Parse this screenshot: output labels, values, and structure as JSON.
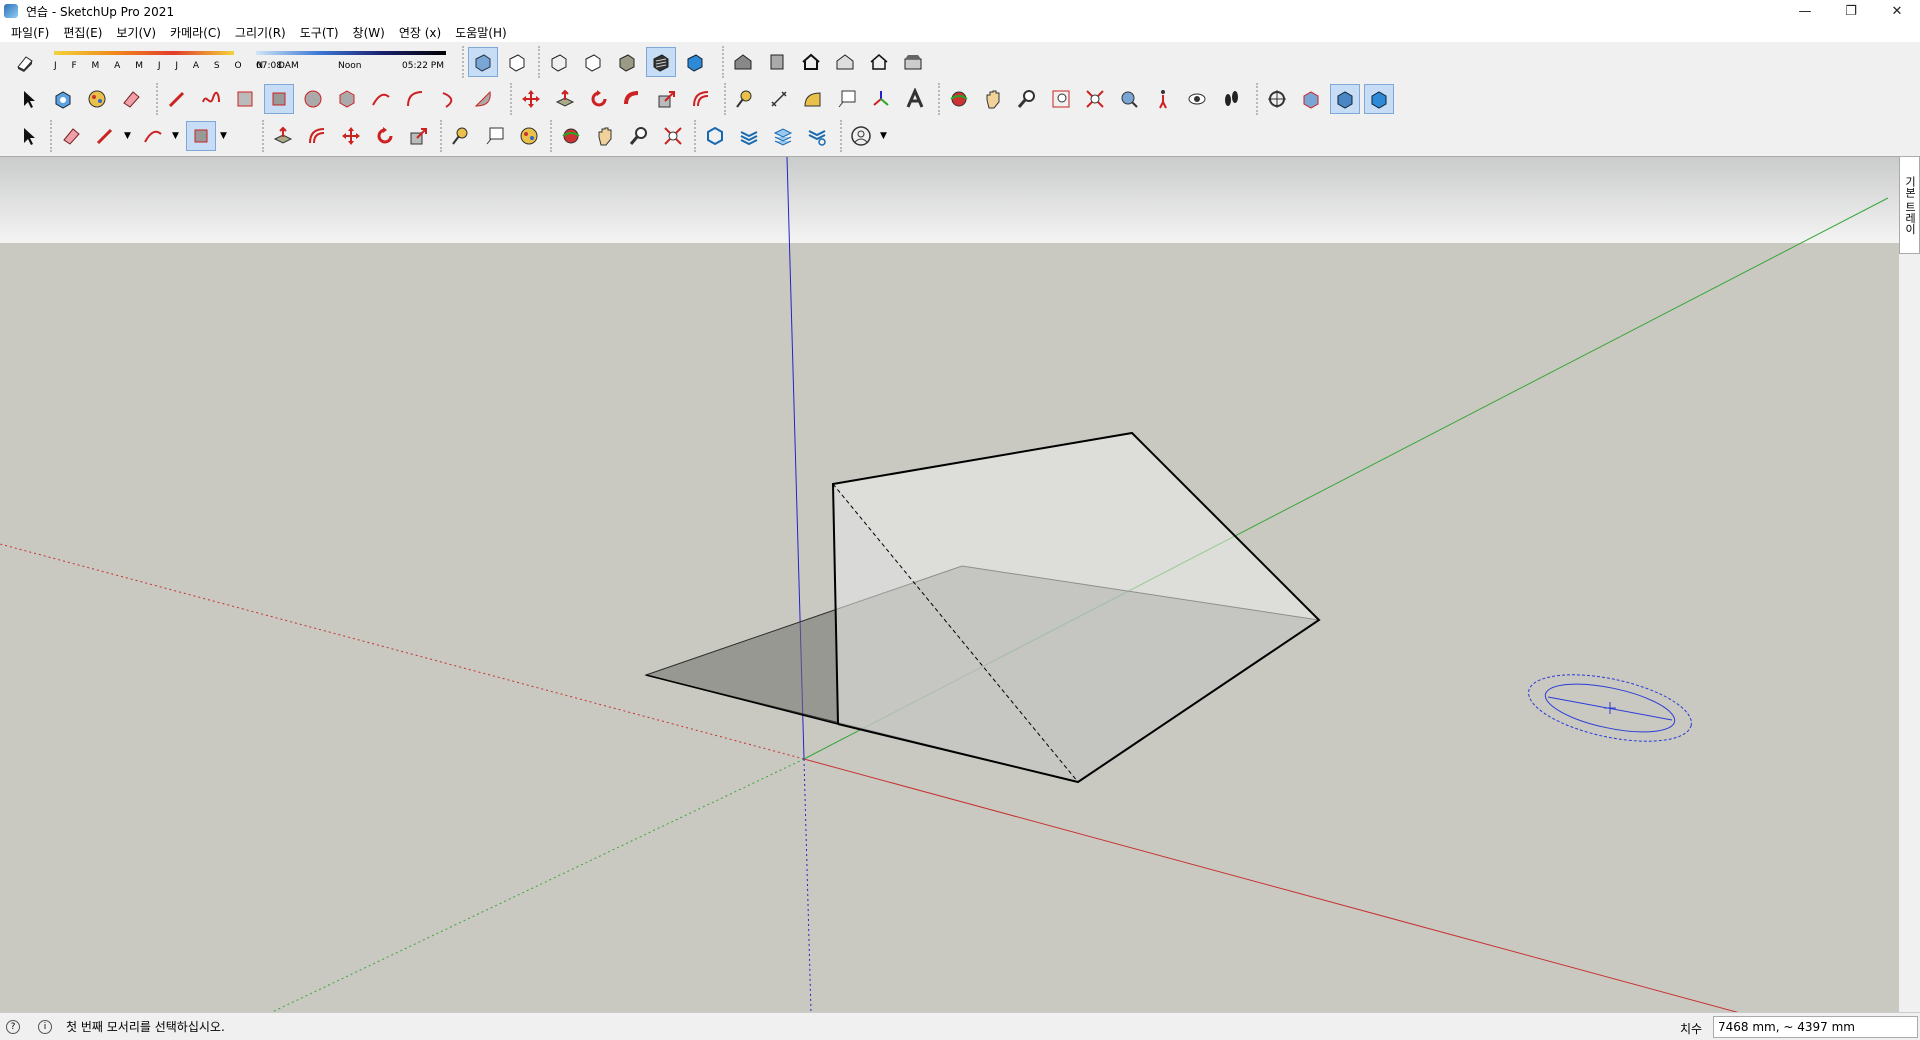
{
  "window": {
    "title": "연습 - SketchUp Pro 2021",
    "minimize": "—",
    "restore": "❐",
    "close": "✕"
  },
  "menu": [
    "파일(F)",
    "편집(E)",
    "보기(V)",
    "카메라(C)",
    "그리기(R)",
    "도구(T)",
    "창(W)",
    "연장 (x)",
    "도움말(H)"
  ],
  "shadows": {
    "months": "J F M A M J J A S O N D",
    "time_start": "07:08 AM",
    "time_mid": "Noon",
    "time_end": "05:22 PM"
  },
  "tray": {
    "label": "기본 트레이"
  },
  "status": {
    "message": "첫 번째 모서리를 선택하십시오.",
    "measure_label": "치수",
    "measure_value": "7468 mm, ~ 4397 mm"
  },
  "colors": {
    "axis_red": "#c83232",
    "axis_green": "#3aa63a",
    "axis_blue": "#2424c8",
    "viewport_bg": "#c9c9c2",
    "protractor": "#2b3bd6"
  }
}
